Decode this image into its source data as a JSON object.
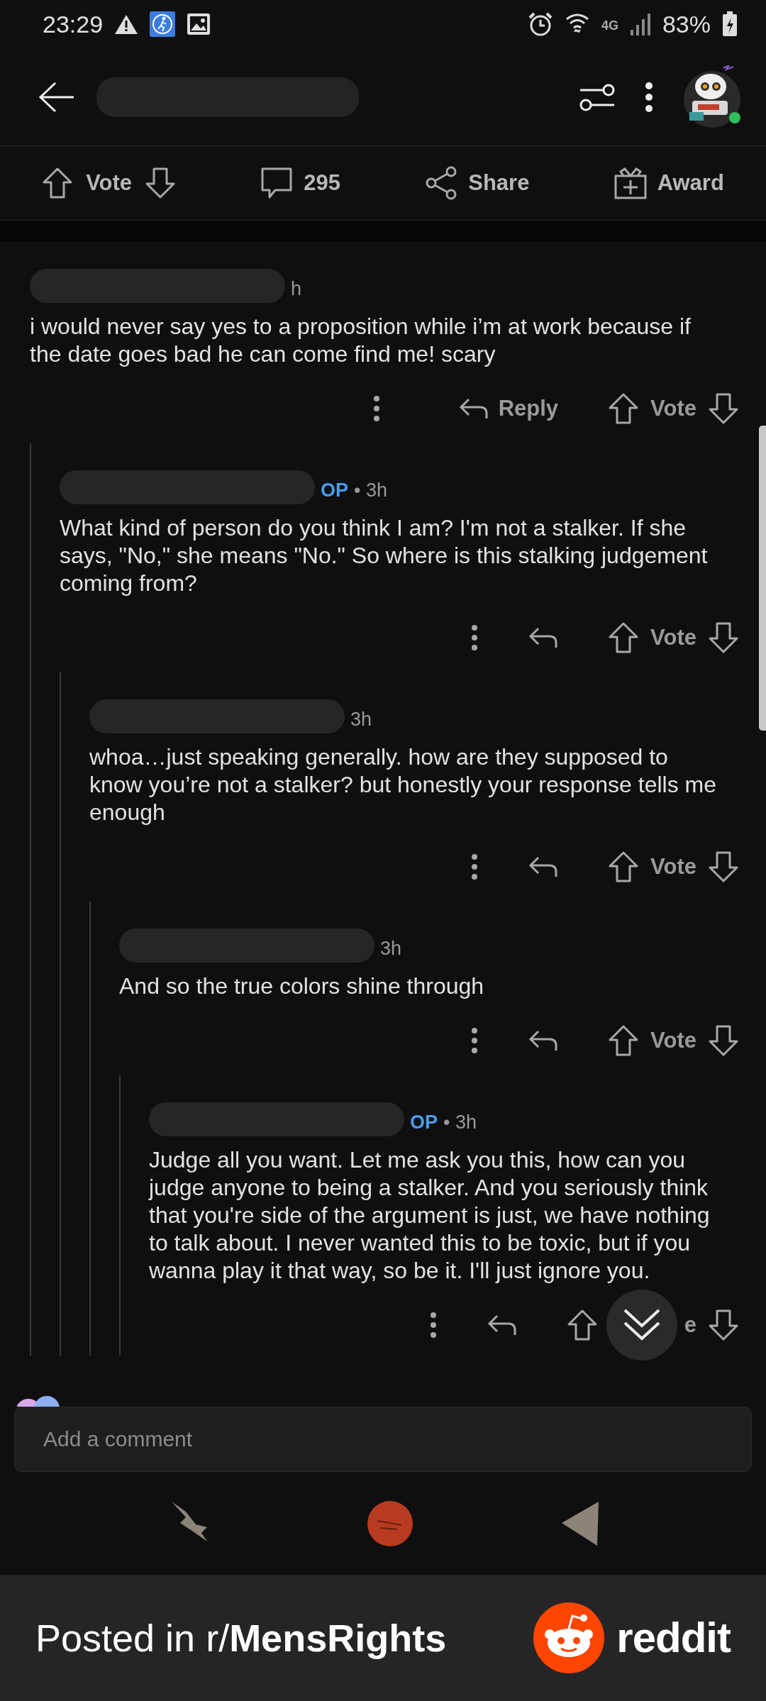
{
  "status_bar": {
    "time": "23:29",
    "network": "4G",
    "battery": "83%"
  },
  "post_actions": {
    "vote_label": "Vote",
    "comment_count": "295",
    "share_label": "Share",
    "award_label": "Award"
  },
  "comments": [
    {
      "time": "h",
      "body": "i would never say yes to a proposition while i’m at work because if the date goes bad he can come find me! scary",
      "reply_label": "Reply",
      "vote_label": "Vote",
      "children": [
        {
          "op_label": "OP",
          "time": "• 3h",
          "body": "What kind of person do you think I am? I'm not a stalker. If she says, \"No,\" she means \"No.\" So where is this stalking judgement coming from?",
          "vote_label": "Vote",
          "children": [
            {
              "time": "3h",
              "body": "whoa…just speaking generally. how are they supposed to know you’re not a stalker? but honestly your response tells me enough",
              "vote_label": "Vote",
              "children": [
                {
                  "time": "3h",
                  "body": "And so the true colors shine through",
                  "vote_label": "Vote",
                  "children": [
                    {
                      "op_label": "OP",
                      "time": "• 3h",
                      "body": "Judge all you want. Let me ask you this, how can you judge anyone to being a stalker. And you seriously think that you're side of the argument is just, we have nothing to talk about. I never wanted this to be toxic, but if you wanna play it that way, so be it. I'll just ignore you.",
                      "vote_label": "e"
                    }
                  ]
                }
              ]
            }
          ]
        }
      ]
    }
  ],
  "comment_box": {
    "placeholder": "Add a comment"
  },
  "banner": {
    "text": "Posted in r/**MensRights**",
    "brand": "reddit"
  }
}
